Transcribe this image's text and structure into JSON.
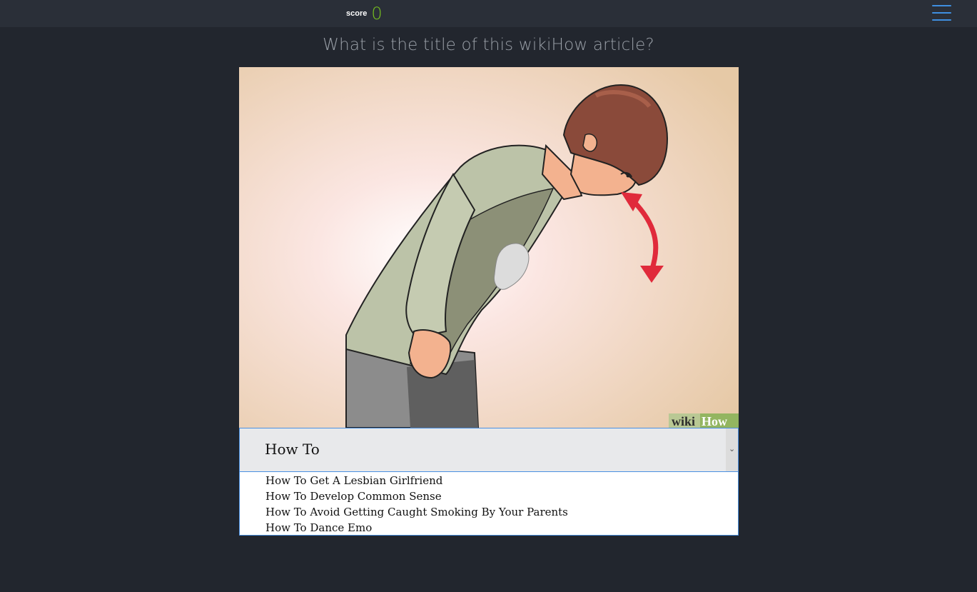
{
  "header": {
    "score_label": "score",
    "score_value": "0",
    "menu_icon": "hamburger-menu-icon"
  },
  "question": {
    "text": "What is the title of this wikiHow article?"
  },
  "image": {
    "watermark_wiki": "wiki",
    "watermark_how": "How"
  },
  "select": {
    "value": "How To",
    "arrow_icon": "chevron-down-icon",
    "options": [
      "How To Get A Lesbian Girlfriend",
      "How To Develop Common Sense",
      "How To Avoid Getting Caught Smoking By Your Parents",
      "How To Dance Emo"
    ]
  },
  "colors": {
    "background": "#22262e",
    "topbar": "#2a2f38",
    "score_accent": "#78c21e",
    "menu_accent": "#3f8fe0",
    "select_border": "#4a90e2"
  }
}
